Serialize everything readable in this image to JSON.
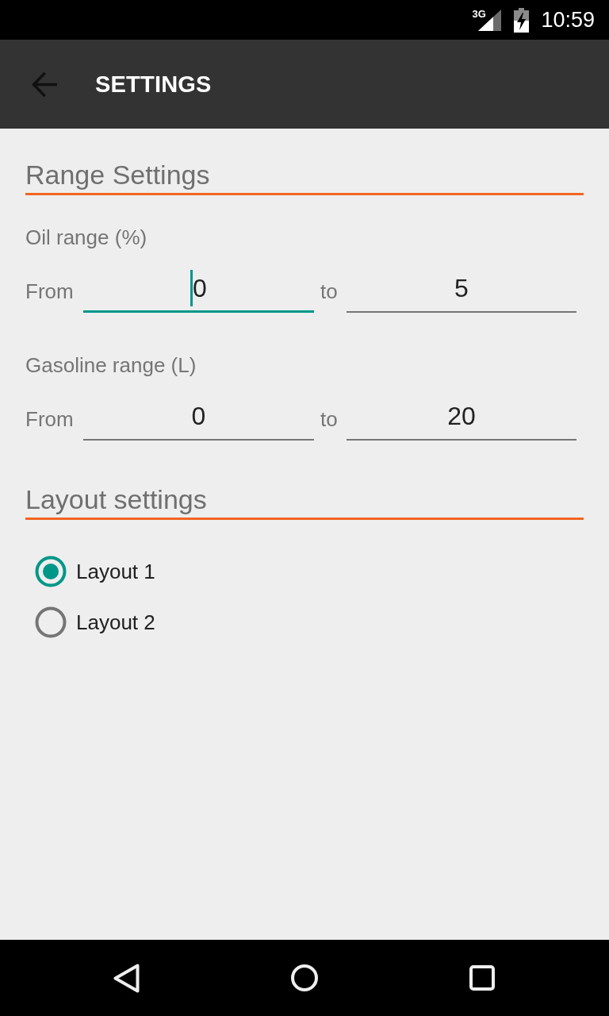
{
  "status_bar": {
    "network_type": "3G",
    "time": "10:59"
  },
  "app_bar": {
    "title": "SETTINGS"
  },
  "range_settings": {
    "title": "Range Settings",
    "ranges": [
      {
        "label": "Oil range (%)",
        "fields": [
          {
            "prefix": "From",
            "value": "0",
            "focused": true
          },
          {
            "prefix": "to",
            "value": "5",
            "focused": false
          }
        ]
      },
      {
        "label": "Gasoline range (L)",
        "fields": [
          {
            "prefix": "From",
            "value": "0",
            "focused": false
          },
          {
            "prefix": "to",
            "value": "20",
            "focused": false
          }
        ]
      }
    ]
  },
  "layout_settings": {
    "title": "Layout settings",
    "options": [
      {
        "label": "Layout 1",
        "selected": true
      },
      {
        "label": "Layout 2",
        "selected": false
      }
    ]
  }
}
